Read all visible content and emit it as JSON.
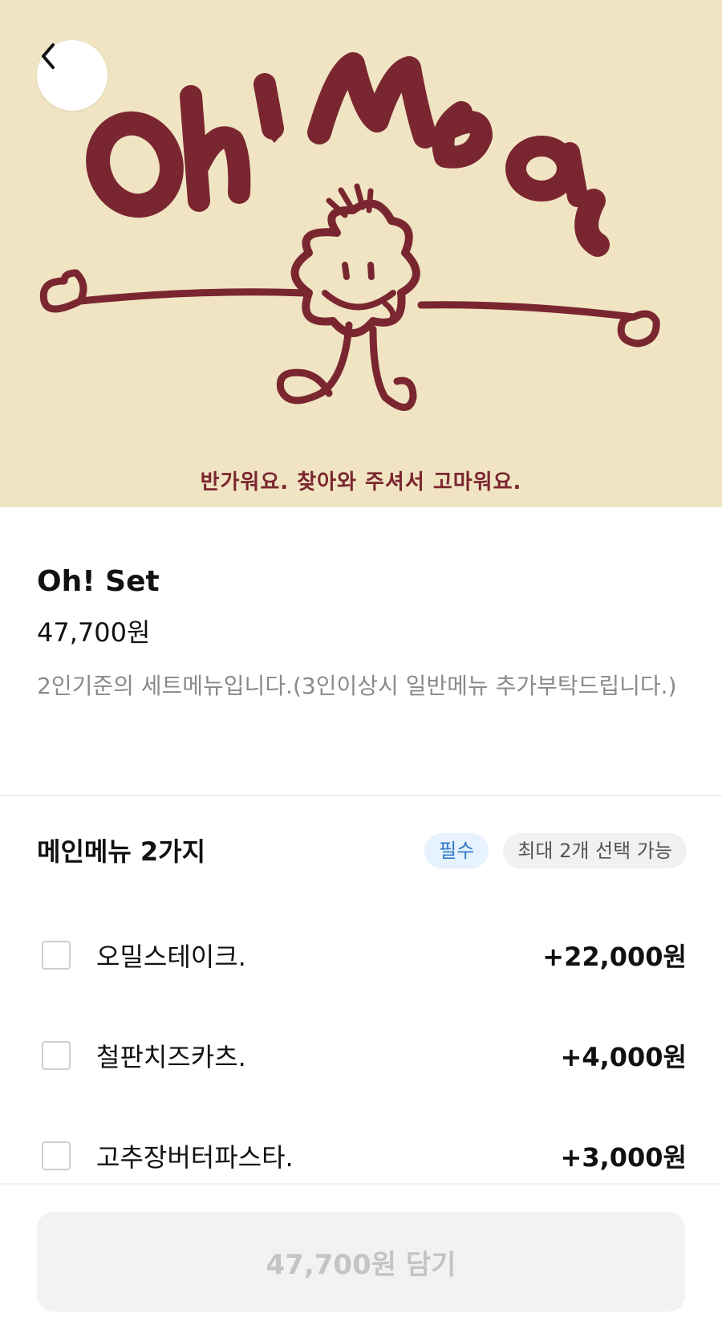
{
  "hero": {
    "logo_text": "Oh! Meal",
    "caption": "반가워요. 찾아와 주셔서 고마워요.",
    "colors": {
      "background": "#f0e4c2",
      "ink": "#7a2630"
    }
  },
  "nav": {
    "back_icon": "chevron-left-icon"
  },
  "item": {
    "title": "Oh! Set",
    "price": "47,700원",
    "description": "2인기준의 세트메뉴입니다.(3인이상시 일반메뉴 추가부탁드립니다.)"
  },
  "option_group": {
    "title": "메인메뉴 2가지",
    "required_badge": "필수",
    "limit_badge": "최대 2개 선택 가능",
    "options": [
      {
        "name": "오밀스테이크.",
        "price": "+22,000원",
        "checked": false
      },
      {
        "name": "철판치즈카츠.",
        "price": "+4,000원",
        "checked": false
      },
      {
        "name": "고추장버터파스타.",
        "price": "+3,000원",
        "checked": false
      }
    ]
  },
  "cta": {
    "label": "47,700원 담기",
    "enabled": false
  }
}
